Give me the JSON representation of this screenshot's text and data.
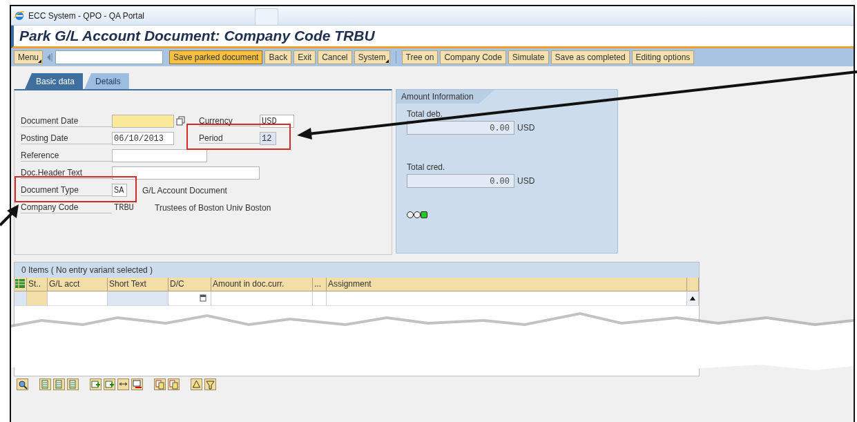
{
  "window": {
    "title": "ECC System - QPO - QA Portal"
  },
  "header": {
    "title": "Park G/L Account Document: Company Code TRBU"
  },
  "toolbar": {
    "menu": "Menu",
    "groups": [
      [
        {
          "label": "Save parked document",
          "kind": "primary"
        },
        {
          "label": "Back",
          "kind": "plain"
        },
        {
          "label": "Exit",
          "kind": "plain"
        },
        {
          "label": "Cancel",
          "kind": "plain"
        },
        {
          "label": "System",
          "kind": "menu"
        }
      ],
      [
        {
          "label": "Tree on",
          "kind": "plain"
        },
        {
          "label": "Company Code",
          "kind": "plain"
        },
        {
          "label": "Simulate",
          "kind": "plain"
        },
        {
          "label": "Save as completed",
          "kind": "plain"
        },
        {
          "label": "Editing options",
          "kind": "plain"
        }
      ]
    ]
  },
  "tabs": [
    {
      "label": "Basic data",
      "selected": true
    },
    {
      "label": "Details",
      "selected": false
    }
  ],
  "form": {
    "fields": [
      {
        "label": "Document Date",
        "kind": "input",
        "required": true,
        "value_help": true,
        "side": {
          "label": "Currency",
          "value": "USD",
          "kind": "input"
        }
      },
      {
        "label": "Posting Date",
        "kind": "input",
        "value": "06/10/2013",
        "required": false,
        "value_help": false,
        "side": {
          "label": "Period",
          "value": "12",
          "kind": "readonly"
        }
      },
      {
        "label": "Reference",
        "kind": "input",
        "required": false,
        "value_help": false
      },
      {
        "label": "Doc.Header Text",
        "kind": "input",
        "required": false,
        "value_help": false
      },
      {
        "label": "Document Type",
        "kind": "input",
        "value": "SA",
        "required": false,
        "value_help": false,
        "description": "G/L Account Document"
      },
      {
        "label": "Company Code",
        "kind": "display",
        "value": "TRBU",
        "required": false,
        "value_help": false,
        "description": "Trustees of Boston Univ Boston"
      }
    ]
  },
  "amount": {
    "title": "Amount Information",
    "totals": [
      {
        "label": "Total deb.",
        "value": "0.00",
        "currency": "USD"
      },
      {
        "label": "Total cred.",
        "value": "0.00",
        "currency": "USD"
      }
    ],
    "traffic_light": {
      "lights": [
        {
          "on": false
        },
        {
          "on": false
        },
        {
          "on": true
        }
      ]
    }
  },
  "table": {
    "title": "0 Items ( No entry variant selected )",
    "columns": [
      "St..",
      "G/L acct",
      "Short Text",
      "D/C",
      "Amount in doc.curr.",
      "...",
      "Assignment"
    ]
  }
}
